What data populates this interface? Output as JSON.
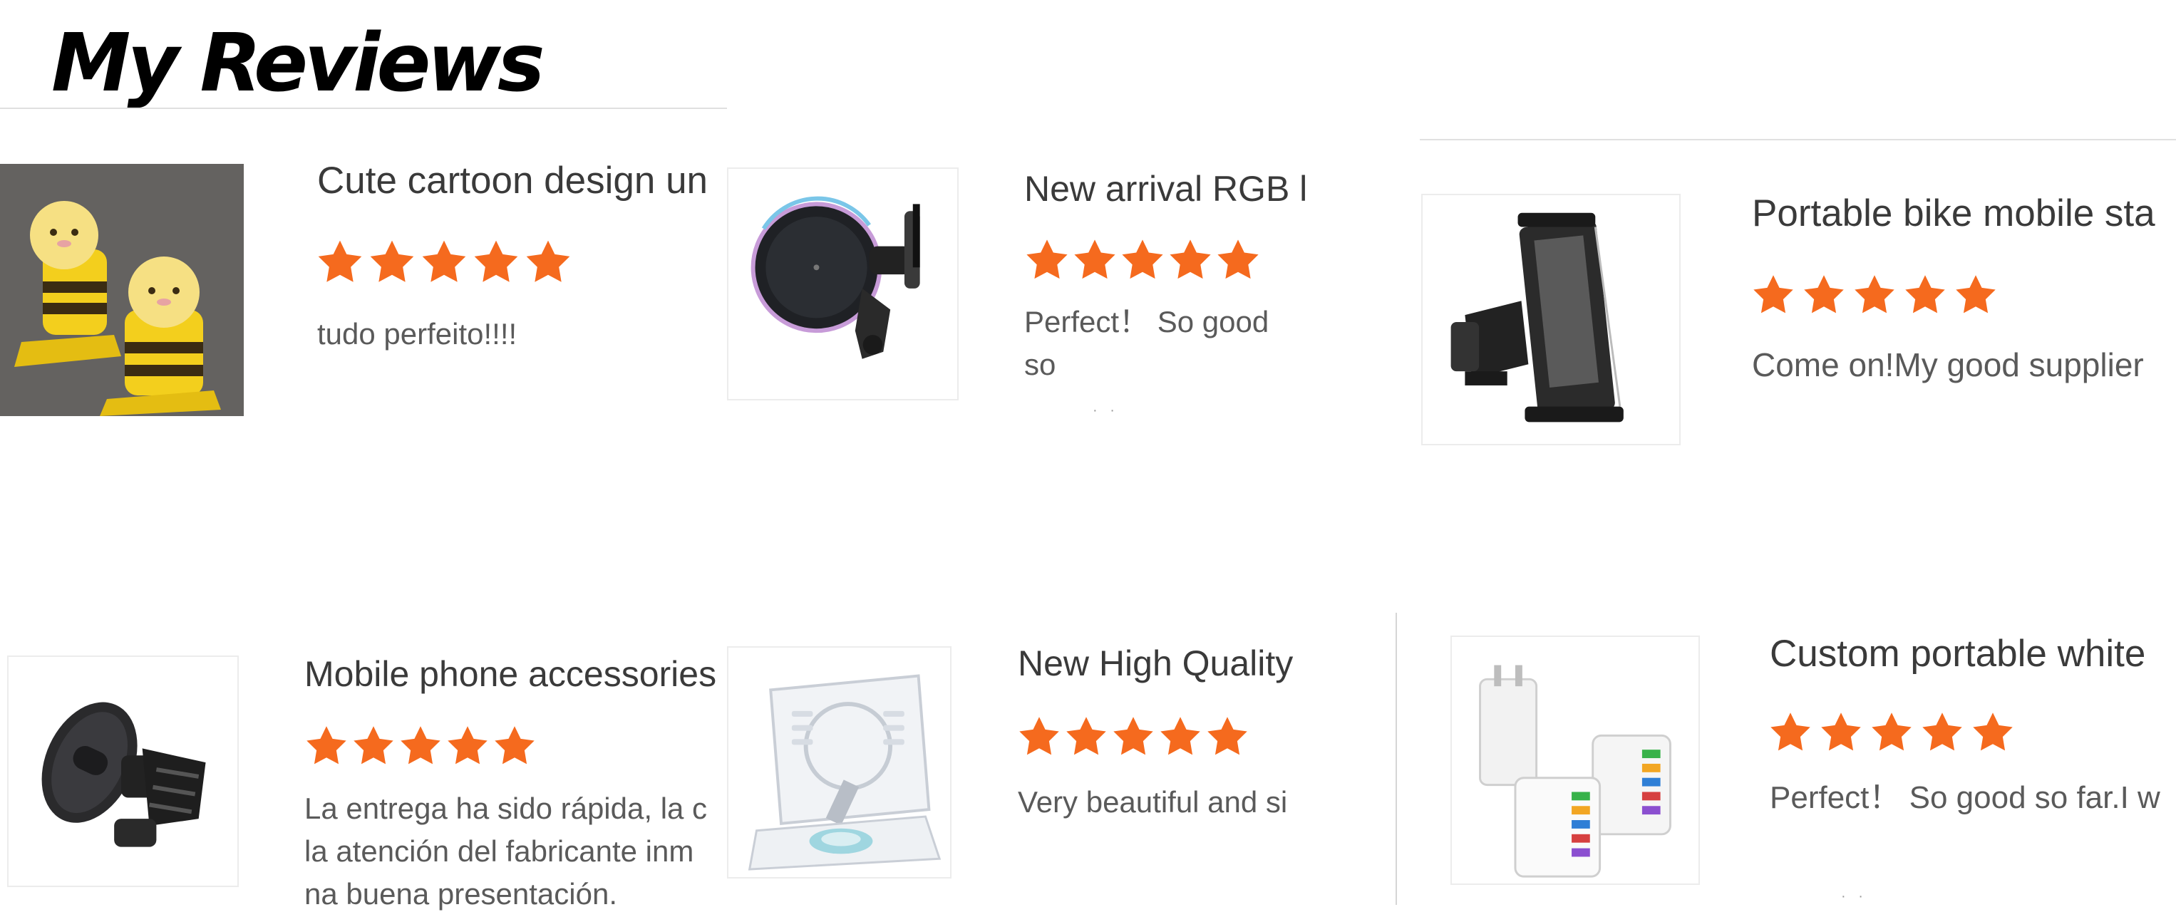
{
  "page": {
    "title": "My Reviews"
  },
  "reviews": [
    {
      "title": "Cute cartoon design un",
      "rating": 5,
      "text": "tudo perfeito!!!!",
      "image_icon": "cartoon-phone-holder-icon"
    },
    {
      "title": "New arrival RGB l",
      "rating": 5,
      "text": "Perfect！ So good so",
      "image_icon": "magnetic-car-mount-icon"
    },
    {
      "title": "Portable bike mobile sta",
      "rating": 5,
      "text": "Come on!My good supplier",
      "image_icon": "tablet-car-mount-icon"
    },
    {
      "title": "Mobile phone accessories",
      "rating": 5,
      "text": "La entrega ha sido rápida, la c\nla atención del fabricante inm\nna buena presentación.",
      "image_icon": "vent-phone-mount-icon"
    },
    {
      "title": "New High Quality",
      "rating": 5,
      "text": "Very beautiful and si",
      "image_icon": "acrylic-magnetic-stand-icon"
    },
    {
      "title": "Custom portable white",
      "rating": 5,
      "text": "Perfect！ So good so far.I w",
      "image_icon": "usb-wall-charger-icon"
    }
  ],
  "colors": {
    "star": "#f56a1e",
    "title_text": "#3a3a3a",
    "review_text": "#5a5a5a"
  }
}
